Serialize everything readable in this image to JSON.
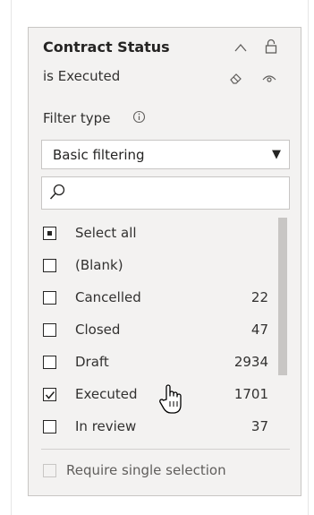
{
  "slicer": {
    "title": "Contract Status",
    "subtitle": "is Executed",
    "filter_type_label": "Filter type",
    "dropdown_value": "Basic filtering",
    "search_placeholder": "",
    "items": [
      {
        "label": "Select all",
        "count": "",
        "state": "partial"
      },
      {
        "label": "(Blank)",
        "count": "",
        "state": "unchecked"
      },
      {
        "label": "Cancelled",
        "count": "22",
        "state": "unchecked"
      },
      {
        "label": "Closed",
        "count": "47",
        "state": "unchecked"
      },
      {
        "label": "Draft",
        "count": "2934",
        "state": "unchecked"
      },
      {
        "label": "Executed",
        "count": "1701",
        "state": "checked"
      },
      {
        "label": "In review",
        "count": "37",
        "state": "unchecked"
      }
    ],
    "require_single_selection_label": "Require single selection"
  },
  "icons": {
    "collapse": "chevron-up-icon",
    "lock": "lock-icon",
    "clear": "eraser-icon",
    "visibility": "eye-icon",
    "info": "info-icon",
    "dropdown": "caret-down-icon",
    "search": "search-icon",
    "cursor": "hand-pointer-icon"
  },
  "colors": {
    "card_background": "#f3f2f1",
    "card_border": "#c8c6c4",
    "text": "#252423",
    "scrollbar": "#c8c6c4"
  }
}
